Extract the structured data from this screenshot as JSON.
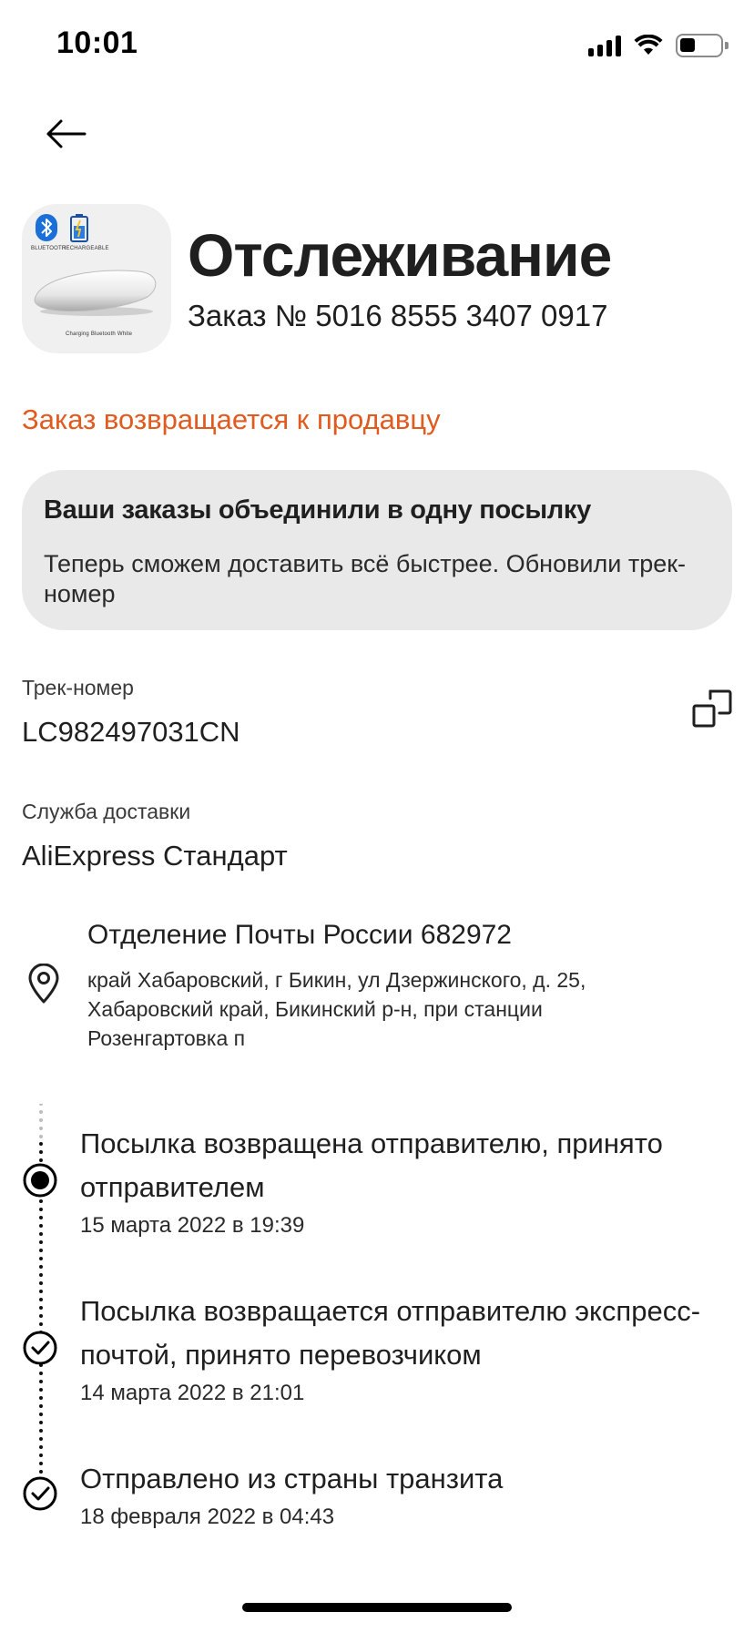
{
  "status_bar": {
    "time": "10:01"
  },
  "header": {
    "title": "Отслеживание",
    "order_number": "Заказ № 5016 8555 3407 0917",
    "product_image_labels": {
      "bluetooth": "BLUETOOTH",
      "rechargeable": "RECHARGEABLE",
      "caption": "Charging Bluetooth White"
    }
  },
  "order_status": "Заказ возвращается к продавцу",
  "info_card": {
    "title": "Ваши заказы объединили в одну посылку",
    "text": "Теперь сможем доставить всё быстрее. Обновили трек-номер"
  },
  "tracking": {
    "label": "Трек-номер",
    "value": "LC982497031CN"
  },
  "delivery_service": {
    "label": "Служба доставки",
    "value": "AliExpress Стандарт"
  },
  "pickup_point": {
    "title": "Отделение Почты России 682972",
    "address": "край Хабаровский, г Бикин, ул Дзержинского, д. 25, Хабаровский край, Бикинский р-н, при станции Розенгартовка п"
  },
  "timeline": [
    {
      "title": "Посылка возвращена отправителю, принято отправителем",
      "date": "15 марта 2022 в 19:39",
      "state": "current"
    },
    {
      "title": "Посылка возвращается отправителю экспресс-почтой, принято перевозчиком",
      "date": "14 марта 2022 в 21:01",
      "state": "done"
    },
    {
      "title": "Отправлено из страны транзита",
      "date": "18 февраля 2022 в 04:43",
      "state": "done"
    }
  ],
  "colors": {
    "accent_status": "#e15a1f",
    "card_bg": "#e9e9e9",
    "text": "#1f1f1f"
  }
}
